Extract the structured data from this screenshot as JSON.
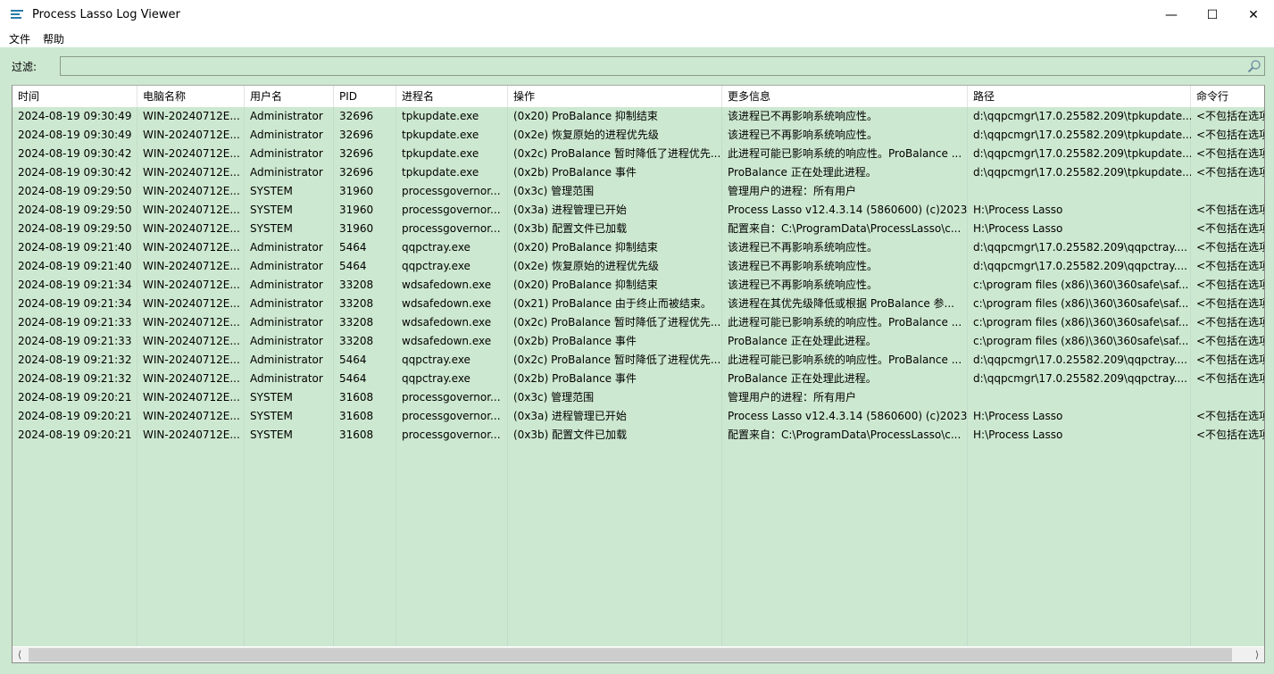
{
  "window": {
    "title": "Process Lasso Log Viewer"
  },
  "menu": [
    "文件",
    "帮助"
  ],
  "filter": {
    "label": "过滤:",
    "value": ""
  },
  "columns": [
    "时间",
    "电脑名称",
    "用户名",
    "PID",
    "进程名",
    "操作",
    "更多信息",
    "路径",
    "命令行"
  ],
  "rows": [
    [
      "2024-08-19 09:30:49",
      "WIN-20240712E...",
      "Administrator",
      "32696",
      "tpkupdate.exe",
      "(0x20) ProBalance 抑制结束",
      "该进程已不再影响系统响应性。",
      "d:\\qqpcmgr\\17.0.25582.209\\tpkupdate...",
      "<不包括在选项"
    ],
    [
      "2024-08-19 09:30:49",
      "WIN-20240712E...",
      "Administrator",
      "32696",
      "tpkupdate.exe",
      "(0x2e) 恢复原始的进程优先级",
      "该进程已不再影响系统响应性。",
      "d:\\qqpcmgr\\17.0.25582.209\\tpkupdate...",
      "<不包括在选项"
    ],
    [
      "2024-08-19 09:30:42",
      "WIN-20240712E...",
      "Administrator",
      "32696",
      "tpkupdate.exe",
      "(0x2c) ProBalance 暂时降低了进程优先...",
      "此进程可能已影响系统的响应性。ProBalance ...",
      "d:\\qqpcmgr\\17.0.25582.209\\tpkupdate...",
      "<不包括在选项"
    ],
    [
      "2024-08-19 09:30:42",
      "WIN-20240712E...",
      "Administrator",
      "32696",
      "tpkupdate.exe",
      "(0x2b) ProBalance 事件",
      "ProBalance 正在处理此进程。",
      "d:\\qqpcmgr\\17.0.25582.209\\tpkupdate...",
      "<不包括在选项"
    ],
    [
      "2024-08-19 09:29:50",
      "WIN-20240712E...",
      "SYSTEM",
      "31960",
      "processgovernor...",
      "(0x3c) 管理范围",
      "管理用户的进程：所有用户",
      "",
      ""
    ],
    [
      "2024-08-19 09:29:50",
      "WIN-20240712E...",
      "SYSTEM",
      "31960",
      "processgovernor...",
      "(0x3a) 进程管理已开始",
      "Process Lasso v12.4.3.14 (5860600) (c)2023...",
      "H:\\Process Lasso",
      "<不包括在选项"
    ],
    [
      "2024-08-19 09:29:50",
      "WIN-20240712E...",
      "SYSTEM",
      "31960",
      "processgovernor...",
      "(0x3b) 配置文件已加载",
      "配置来自：C:\\ProgramData\\ProcessLasso\\c...",
      "H:\\Process Lasso",
      "<不包括在选项"
    ],
    [
      "2024-08-19 09:21:40",
      "WIN-20240712E...",
      "Administrator",
      "5464",
      "qqpctray.exe",
      "(0x20) ProBalance 抑制结束",
      "该进程已不再影响系统响应性。",
      "d:\\qqpcmgr\\17.0.25582.209\\qqpctray....",
      "<不包括在选项"
    ],
    [
      "2024-08-19 09:21:40",
      "WIN-20240712E...",
      "Administrator",
      "5464",
      "qqpctray.exe",
      "(0x2e) 恢复原始的进程优先级",
      "该进程已不再影响系统响应性。",
      "d:\\qqpcmgr\\17.0.25582.209\\qqpctray....",
      "<不包括在选项"
    ],
    [
      "2024-08-19 09:21:34",
      "WIN-20240712E...",
      "Administrator",
      "33208",
      "wdsafedown.exe",
      "(0x20) ProBalance 抑制结束",
      "该进程已不再影响系统响应性。",
      "c:\\program files (x86)\\360\\360safe\\saf...",
      "<不包括在选项"
    ],
    [
      "2024-08-19 09:21:34",
      "WIN-20240712E...",
      "Administrator",
      "33208",
      "wdsafedown.exe",
      "(0x21) ProBalance 由于终止而被结束。",
      "该进程在其优先级降低或根据 ProBalance 参...",
      "c:\\program files (x86)\\360\\360safe\\saf...",
      "<不包括在选项"
    ],
    [
      "2024-08-19 09:21:33",
      "WIN-20240712E...",
      "Administrator",
      "33208",
      "wdsafedown.exe",
      "(0x2c) ProBalance 暂时降低了进程优先...",
      "此进程可能已影响系统的响应性。ProBalance ...",
      "c:\\program files (x86)\\360\\360safe\\saf...",
      "<不包括在选项"
    ],
    [
      "2024-08-19 09:21:33",
      "WIN-20240712E...",
      "Administrator",
      "33208",
      "wdsafedown.exe",
      "(0x2b) ProBalance 事件",
      "ProBalance 正在处理此进程。",
      "c:\\program files (x86)\\360\\360safe\\saf...",
      "<不包括在选项"
    ],
    [
      "2024-08-19 09:21:32",
      "WIN-20240712E...",
      "Administrator",
      "5464",
      "qqpctray.exe",
      "(0x2c) ProBalance 暂时降低了进程优先...",
      "此进程可能已影响系统的响应性。ProBalance ...",
      "d:\\qqpcmgr\\17.0.25582.209\\qqpctray....",
      "<不包括在选项"
    ],
    [
      "2024-08-19 09:21:32",
      "WIN-20240712E...",
      "Administrator",
      "5464",
      "qqpctray.exe",
      "(0x2b) ProBalance 事件",
      "ProBalance 正在处理此进程。",
      "d:\\qqpcmgr\\17.0.25582.209\\qqpctray....",
      "<不包括在选项"
    ],
    [
      "2024-08-19 09:20:21",
      "WIN-20240712E...",
      "SYSTEM",
      "31608",
      "processgovernor...",
      "(0x3c) 管理范围",
      "管理用户的进程：所有用户",
      "",
      ""
    ],
    [
      "2024-08-19 09:20:21",
      "WIN-20240712E...",
      "SYSTEM",
      "31608",
      "processgovernor...",
      "(0x3a) 进程管理已开始",
      "Process Lasso v12.4.3.14 (5860600) (c)2023...",
      "H:\\Process Lasso",
      "<不包括在选项"
    ],
    [
      "2024-08-19 09:20:21",
      "WIN-20240712E...",
      "SYSTEM",
      "31608",
      "processgovernor...",
      "(0x3b) 配置文件已加载",
      "配置来自：C:\\ProgramData\\ProcessLasso\\c...",
      "H:\\Process Lasso",
      "<不包括在选项"
    ]
  ],
  "colors": {
    "background": "#cde8d0",
    "header": "#ffffff"
  }
}
